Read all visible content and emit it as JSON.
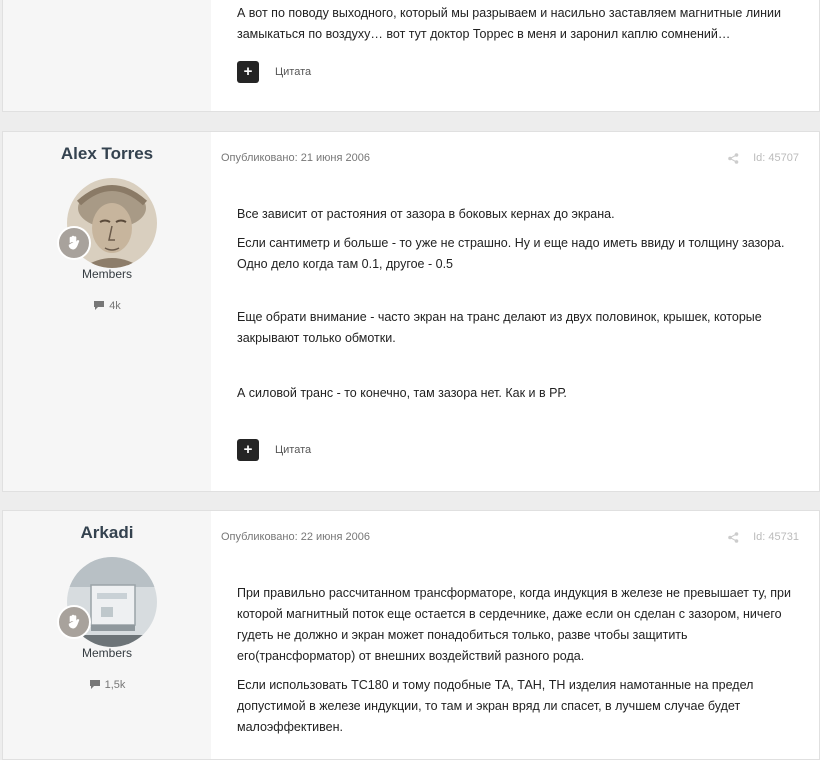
{
  "posts": [
    {
      "text": [
        "А вот по поводу выходного, который мы разрываем и насильно заставляем магнитные линии замыкаться по воздуху… вот тут доктор Торрес в меня и заронил каплю сомнений…"
      ],
      "quote_label": "Цитата"
    },
    {
      "author": "Alex Torres",
      "group": "Members",
      "post_count": "4k",
      "date": "Опубликовано: 21 июня 2006",
      "post_id": "Id: 45707",
      "text": [
        "Все зависит от растояния от зазора в боковых кернах до экрана.",
        "Если сантиметр и больше - то уже не страшно. Ну и еще надо иметь ввиду и толщину зазора. Одно дело когда там 0.1, другое - 0.5",
        "Еще обрати внимание - часто экран на транс делают из двух половинок, крышек, которые закрывают только обмотки.",
        "А силовой транс - то конечно, там зазора нет. Как и в РР."
      ],
      "quote_label": "Цитата"
    },
    {
      "author": "Arkadi",
      "group": "Members",
      "post_count": "1,5k",
      "date": "Опубликовано: 22 июня 2006",
      "post_id": "Id: 45731",
      "text": [
        "При правильно рассчитанном трансформаторе, когда индукция в железе не превышает ту, при которой магнитный поток еще остается в сердечнике, даже если он сделан с зазором, ничего гудеть не должно и экран может понадобиться только, разве чтобы защитить его(трансформатор) от внешних воздействий разного рода.",
        "Если использовать ТС180 и тому подобные ТА, ТАН, ТН изделия намотанные на предел допустимой в железе индукции, то там и экран вряд ли спасет, в лучшем случае будет малоэффективен."
      ]
    }
  ],
  "icons": {
    "plus": "+",
    "share": "share-icon",
    "comment": "comment-icon",
    "badge": "hand-badge-icon"
  }
}
